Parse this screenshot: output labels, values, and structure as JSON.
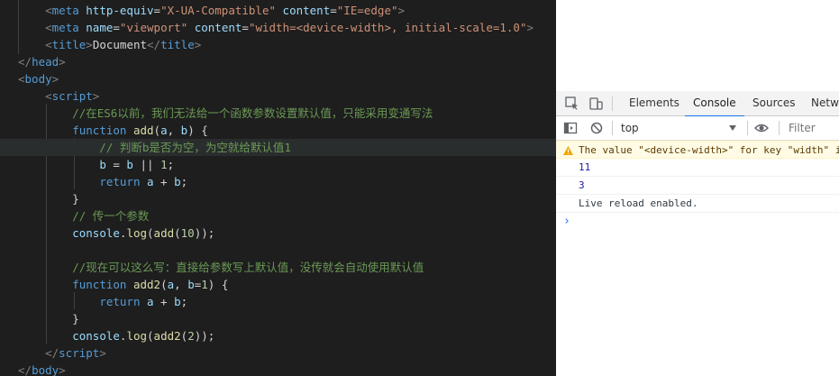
{
  "editor": {
    "lines": [
      {
        "segs": [
          [
            "br",
            "    <"
          ],
          [
            "tag",
            "meta "
          ],
          [
            "attr",
            "http-equiv"
          ],
          [
            "txt",
            "="
          ],
          [
            "str",
            "\"X-UA-Compatible\""
          ],
          [
            "txt",
            " "
          ],
          [
            "attr",
            "content"
          ],
          [
            "txt",
            "="
          ],
          [
            "str",
            "\"IE=edge\""
          ],
          [
            "br",
            ">"
          ]
        ]
      },
      {
        "segs": [
          [
            "br",
            "    <"
          ],
          [
            "tag",
            "meta "
          ],
          [
            "attr",
            "name"
          ],
          [
            "txt",
            "="
          ],
          [
            "str",
            "\"viewport\""
          ],
          [
            "txt",
            " "
          ],
          [
            "attr",
            "content"
          ],
          [
            "txt",
            "="
          ],
          [
            "str",
            "\"width=<device-width>, initial-scale=1.0\""
          ],
          [
            "br",
            ">"
          ]
        ]
      },
      {
        "segs": [
          [
            "br",
            "    <"
          ],
          [
            "tag",
            "title"
          ],
          [
            "br",
            ">"
          ],
          [
            "txt",
            "Document"
          ],
          [
            "br",
            "</"
          ],
          [
            "tag",
            "title"
          ],
          [
            "br",
            ">"
          ]
        ]
      },
      {
        "segs": [
          [
            "br",
            "</"
          ],
          [
            "tag",
            "head"
          ],
          [
            "br",
            ">"
          ]
        ]
      },
      {
        "segs": [
          [
            "br",
            "<"
          ],
          [
            "tag",
            "body"
          ],
          [
            "br",
            ">"
          ]
        ]
      },
      {
        "segs": [
          [
            "br",
            "    <"
          ],
          [
            "tag",
            "script"
          ],
          [
            "br",
            ">"
          ]
        ]
      },
      {
        "segs": [
          [
            "cmt",
            "        //在ES6以前，我们无法给一个函数参数设置默认值，只能采用变通写法"
          ]
        ]
      },
      {
        "segs": [
          [
            "txt",
            "        "
          ],
          [
            "kw",
            "function "
          ],
          [
            "fn",
            "add"
          ],
          [
            "txt",
            "("
          ],
          [
            "var",
            "a"
          ],
          [
            "txt",
            ", "
          ],
          [
            "var",
            "b"
          ],
          [
            "txt",
            ") "
          ],
          [
            "txt",
            "{"
          ]
        ]
      },
      {
        "segs": [
          [
            "cmt",
            "            // 判断b是否为空，为空就给默认值1"
          ]
        ],
        "active": true
      },
      {
        "segs": [
          [
            "txt",
            "            "
          ],
          [
            "var",
            "b"
          ],
          [
            "txt",
            " = "
          ],
          [
            "var",
            "b"
          ],
          [
            "txt",
            " || "
          ],
          [
            "num",
            "1"
          ],
          [
            "txt",
            ";"
          ]
        ]
      },
      {
        "segs": [
          [
            "txt",
            "            "
          ],
          [
            "kw",
            "return "
          ],
          [
            "var",
            "a"
          ],
          [
            "txt",
            " + "
          ],
          [
            "var",
            "b"
          ],
          [
            "txt",
            ";"
          ]
        ]
      },
      {
        "segs": [
          [
            "txt",
            "        }"
          ]
        ]
      },
      {
        "segs": [
          [
            "cmt",
            "        // 传一个参数"
          ]
        ]
      },
      {
        "segs": [
          [
            "txt",
            "        "
          ],
          [
            "var",
            "console"
          ],
          [
            "txt",
            "."
          ],
          [
            "fn",
            "log"
          ],
          [
            "txt",
            "("
          ],
          [
            "fn",
            "add"
          ],
          [
            "txt",
            "("
          ],
          [
            "num",
            "10"
          ],
          [
            "txt",
            "));"
          ]
        ]
      },
      {
        "segs": [
          [
            "txt",
            ""
          ]
        ]
      },
      {
        "segs": [
          [
            "cmt",
            "        //现在可以这么写：直接给参数写上默认值，没传就会自动使用默认值"
          ]
        ]
      },
      {
        "segs": [
          [
            "txt",
            "        "
          ],
          [
            "kw",
            "function "
          ],
          [
            "fn",
            "add2"
          ],
          [
            "txt",
            "("
          ],
          [
            "var",
            "a"
          ],
          [
            "txt",
            ", "
          ],
          [
            "var",
            "b"
          ],
          [
            "txt",
            "="
          ],
          [
            "num",
            "1"
          ],
          [
            "txt",
            ") {"
          ]
        ]
      },
      {
        "segs": [
          [
            "txt",
            "            "
          ],
          [
            "kw",
            "return "
          ],
          [
            "var",
            "a"
          ],
          [
            "txt",
            " + "
          ],
          [
            "var",
            "b"
          ],
          [
            "txt",
            ";"
          ]
        ]
      },
      {
        "segs": [
          [
            "txt",
            "        }"
          ]
        ]
      },
      {
        "segs": [
          [
            "txt",
            "        "
          ],
          [
            "var",
            "console"
          ],
          [
            "txt",
            "."
          ],
          [
            "fn",
            "log"
          ],
          [
            "txt",
            "("
          ],
          [
            "fn",
            "add2"
          ],
          [
            "txt",
            "("
          ],
          [
            "num",
            "2"
          ],
          [
            "txt",
            "));"
          ]
        ]
      },
      {
        "segs": [
          [
            "br",
            "    </"
          ],
          [
            "tag",
            "script"
          ],
          [
            "br",
            ">"
          ]
        ]
      },
      {
        "segs": [
          [
            "br",
            "</"
          ],
          [
            "tag",
            "body"
          ],
          [
            "br",
            ">"
          ]
        ]
      }
    ]
  },
  "devtools": {
    "tabs": {
      "elements": "Elements",
      "console": "Console",
      "sources": "Sources",
      "network": "Netwo"
    },
    "toolbar": {
      "context": "top",
      "filter_placeholder": "Filter"
    },
    "messages": {
      "warning": "The value \"<device-width>\" for key \"width\" i",
      "out1": "11",
      "out2": "3",
      "reload": "Live reload enabled.",
      "prompt": "›"
    },
    "icons": {
      "inspect": "inspect-icon",
      "device": "device-toggle-icon",
      "sidebar": "sidebar-icon",
      "clear": "clear-console-icon",
      "eye": "live-expression-icon",
      "warn": "warning-icon",
      "dropdown": "chevron-down-icon"
    },
    "colors": {
      "accent": "#1a73e8",
      "warn_bg": "#fffbe5",
      "number": "#1a1aa6"
    }
  }
}
